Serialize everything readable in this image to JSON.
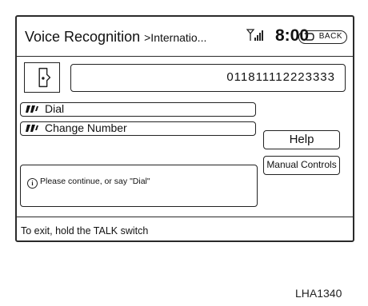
{
  "header": {
    "title": "Voice Recognition",
    "breadcrumb": ">Internatio...",
    "signal_icon": "signal-strength-icon",
    "clock": "8:00",
    "back_label": "BACK",
    "back_icon": "return-arrow-icon"
  },
  "phone": {
    "icon": "phone-handset-icon",
    "number": "011811112223333"
  },
  "commands": [
    {
      "label": "Dial",
      "icon": "voice-command-icon"
    },
    {
      "label": "Change Number",
      "icon": "voice-command-icon"
    }
  ],
  "buttons": {
    "help": "Help",
    "manual_controls": "Manual Controls"
  },
  "message": {
    "icon": "info-icon",
    "text": "Please continue, or say \"Dial\""
  },
  "footer": {
    "text": "To exit, hold the TALK switch"
  },
  "reference_code": "LHA1340"
}
